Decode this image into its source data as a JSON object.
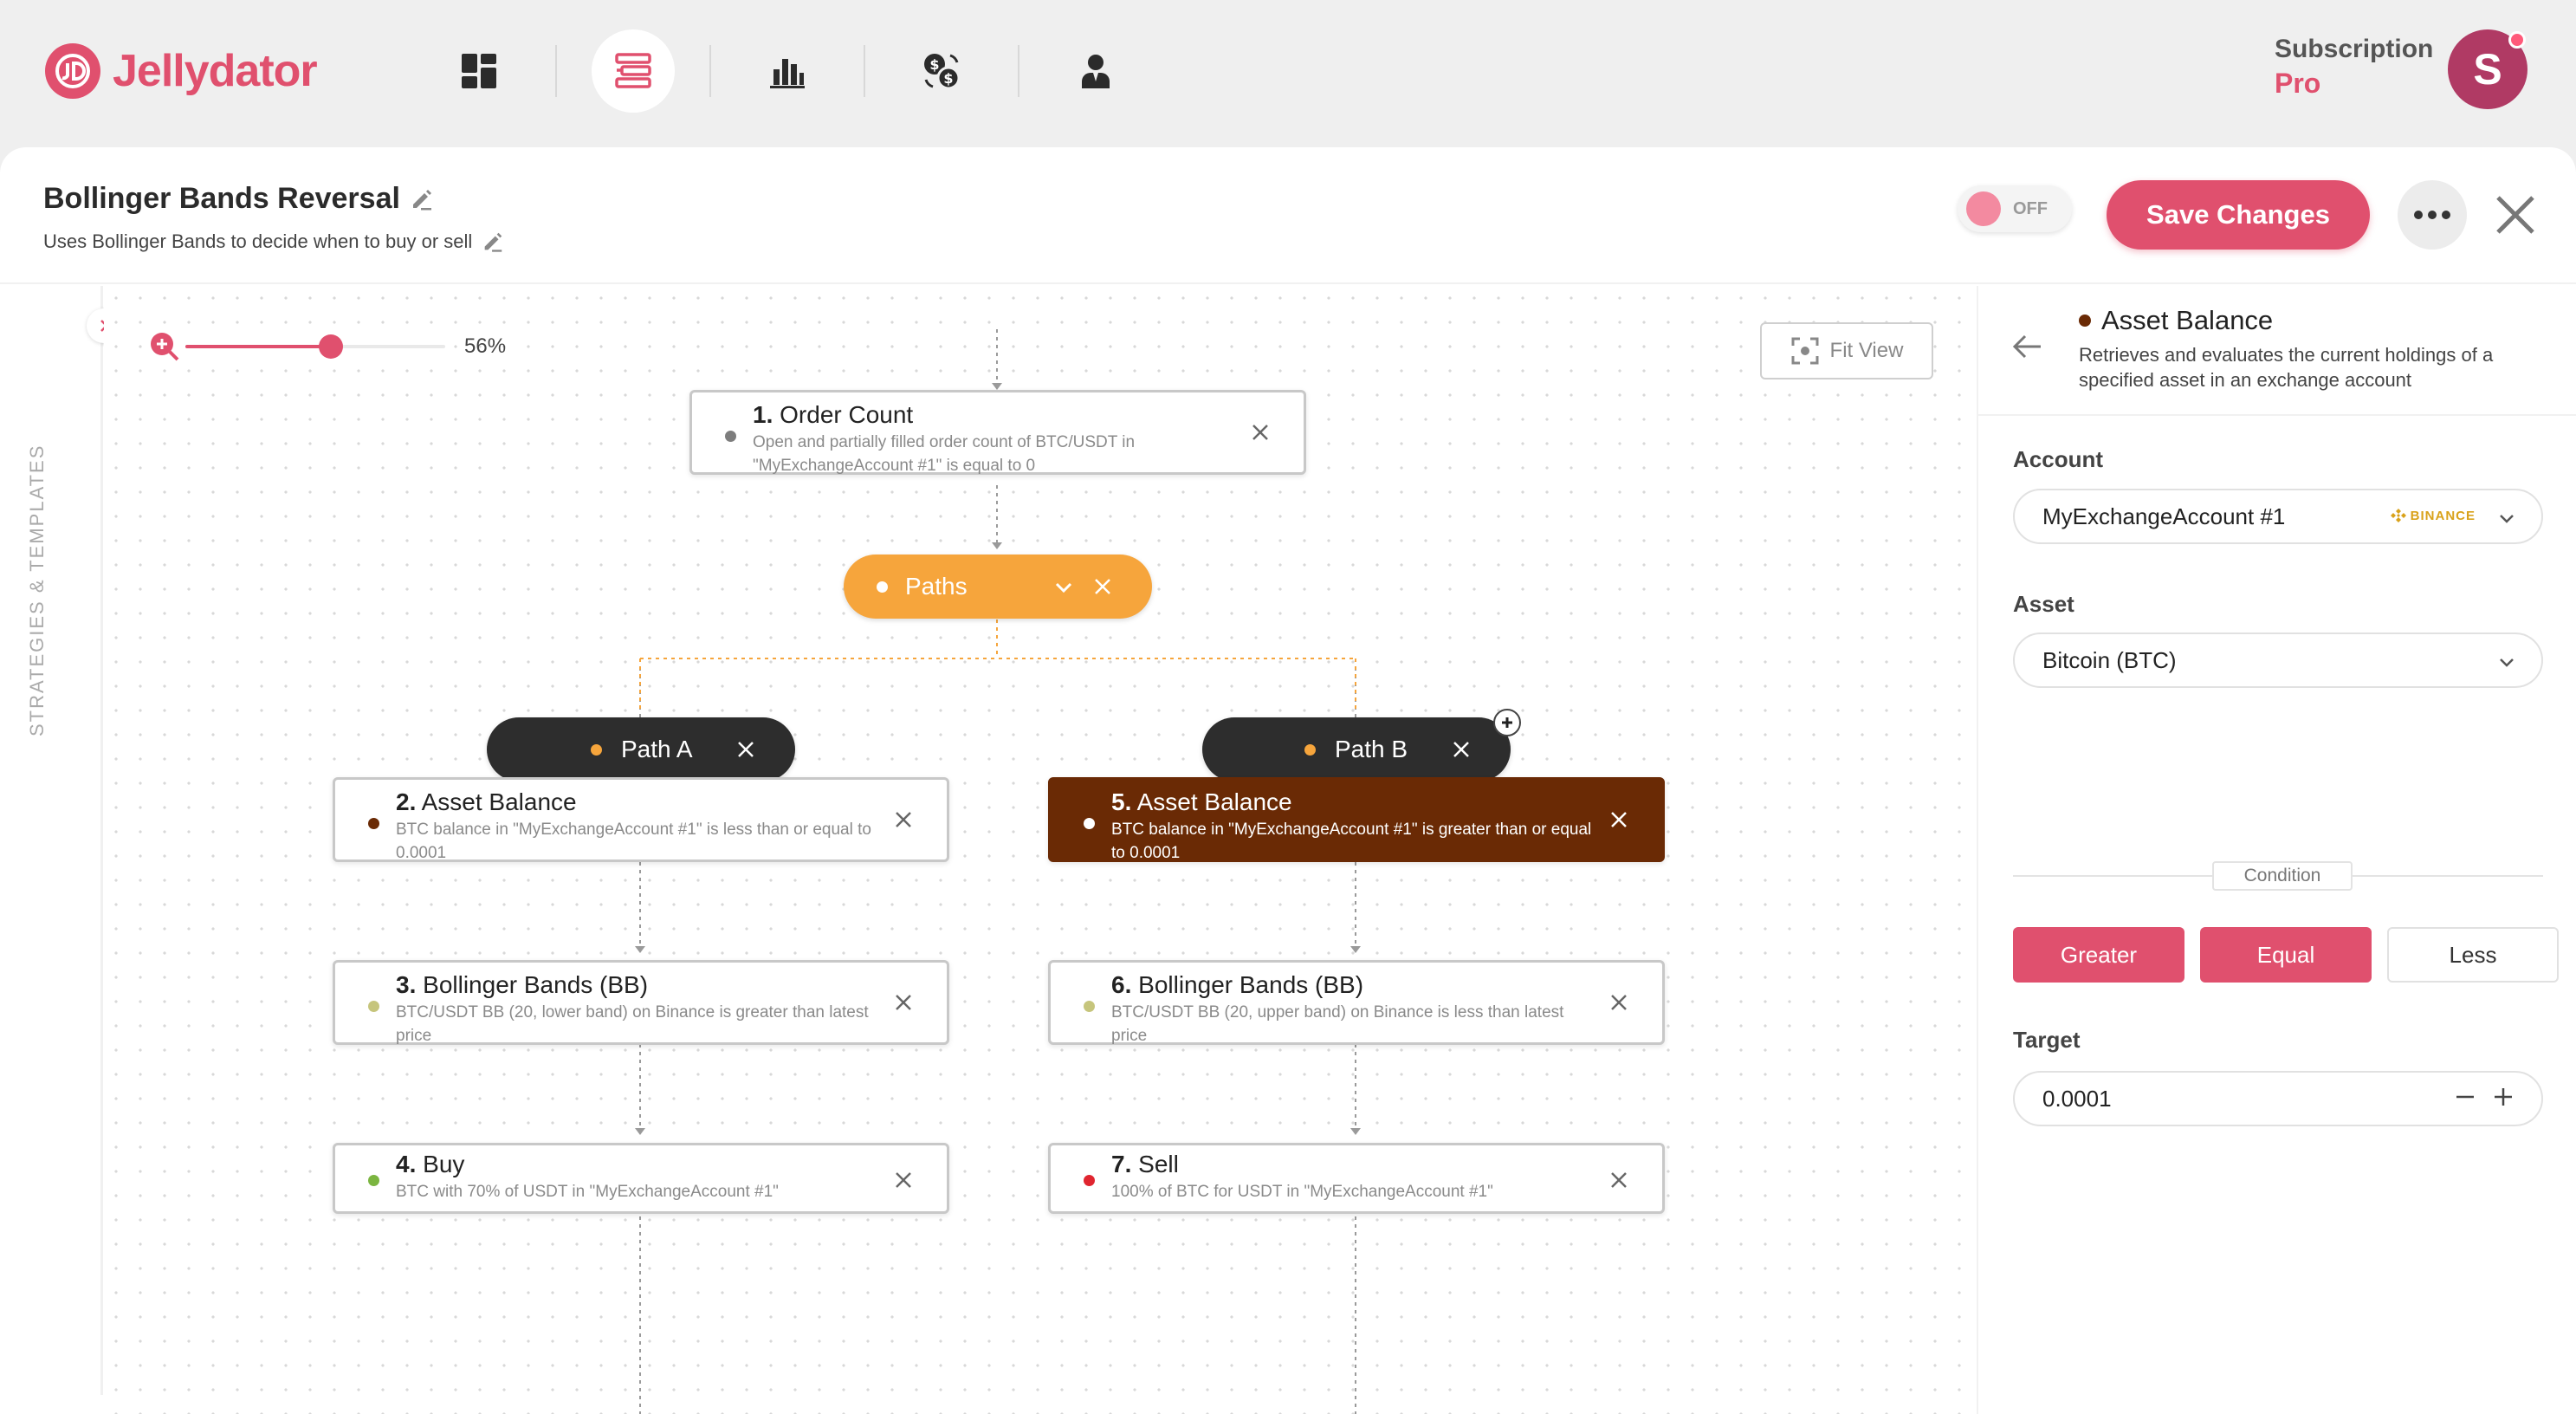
{
  "app": {
    "name": "Jellydator",
    "logo_letters": "JD"
  },
  "nav": {
    "items": [
      "dashboard",
      "strategies",
      "analytics",
      "exchange",
      "account"
    ]
  },
  "subscription": {
    "label": "Subscription",
    "value": "Pro"
  },
  "user": {
    "initial": "S"
  },
  "strategy": {
    "title": "Bollinger Bands Reversal",
    "description": "Uses Bollinger Bands to decide when to buy or sell",
    "toggle_label": "OFF",
    "save_label": "Save Changes"
  },
  "sidebar": {
    "label": "STRATEGIES & TEMPLATES"
  },
  "canvas": {
    "zoom_level": "56%",
    "zoom_fraction": 0.56,
    "fit_view_label": "Fit View",
    "nodes": {
      "n1": {
        "num": "1.",
        "title": "Order Count",
        "desc": "Open and partially filled order count of BTC/USDT in \"MyExchangeAccount #1\" is equal to 0"
      },
      "paths": {
        "label": "Paths"
      },
      "path_a": {
        "label": "Path A"
      },
      "path_b": {
        "label": "Path B"
      },
      "n2": {
        "num": "2.",
        "title": "Asset Balance",
        "desc": "BTC balance in \"MyExchangeAccount #1\" is less than or equal to 0.0001"
      },
      "n3": {
        "num": "3.",
        "title": "Bollinger Bands (BB)",
        "desc": "BTC/USDT BB (20, lower band) on Binance is greater than latest price"
      },
      "n4": {
        "num": "4.",
        "title": "Buy",
        "desc": "BTC with 70% of USDT in \"MyExchangeAccount #1\""
      },
      "n5": {
        "num": "5.",
        "title": "Asset Balance",
        "desc": "BTC balance in \"MyExchangeAccount #1\" is greater than or equal to 0.0001"
      },
      "n6": {
        "num": "6.",
        "title": "Bollinger Bands (BB)",
        "desc": "BTC/USDT BB (20, upper band) on Binance is less than latest price"
      },
      "n7": {
        "num": "7.",
        "title": "Sell",
        "desc": "100% of BTC for USDT in \"MyExchangeAccount #1\""
      }
    },
    "colors": {
      "neutral": "#7d7d7d",
      "balance": "#6a2a05",
      "indicator": "#c6c57c",
      "buy": "#7bb540",
      "sell": "#e0252f",
      "paths": "#f6a53c"
    }
  },
  "details": {
    "title": "Asset Balance",
    "description": "Retrieves and evaluates the current holdings of a specified asset in an exchange account",
    "account": {
      "label": "Account",
      "value": "MyExchangeAccount #1",
      "exchange_badge": "BINANCE"
    },
    "asset": {
      "label": "Asset",
      "value": "Bitcoin (BTC)"
    },
    "condition": {
      "label": "Condition",
      "options": [
        "Greater",
        "Equal",
        "Less"
      ],
      "selected": [
        "Greater",
        "Equal"
      ]
    },
    "target": {
      "label": "Target",
      "value": "0.0001"
    }
  },
  "theme": {
    "accent": "#e0506e"
  }
}
